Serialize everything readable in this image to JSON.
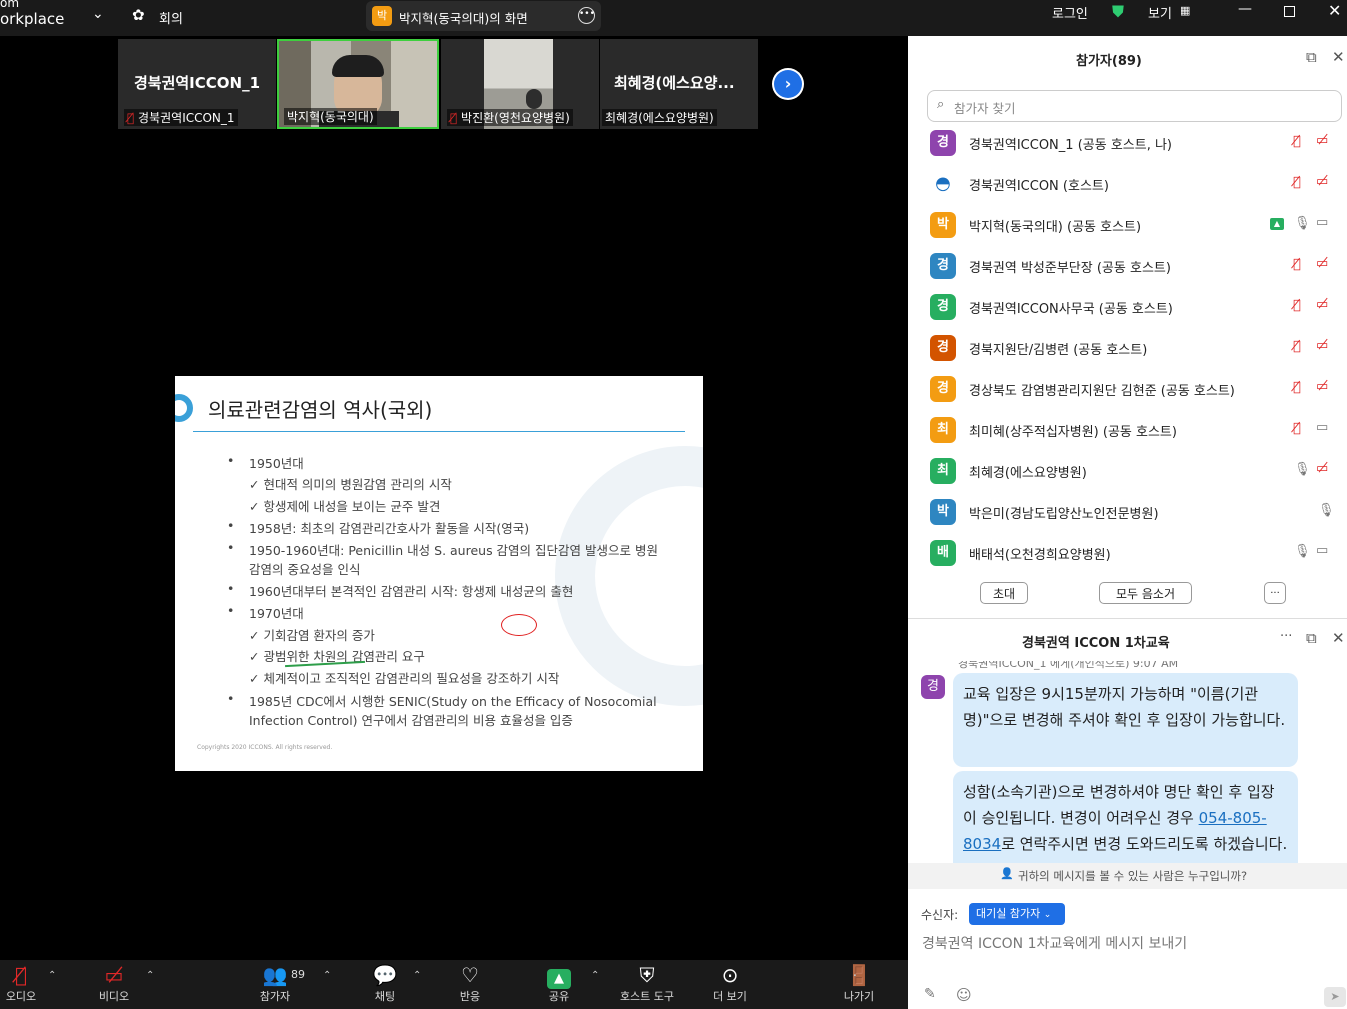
{
  "app": {
    "title_partial": "om",
    "name_partial": "orkplace",
    "meeting_label": "회의"
  },
  "share_banner": {
    "badge": "박",
    "text": "박지혁(동국의대)의 화면"
  },
  "window": {
    "login": "로그인",
    "view": "보기"
  },
  "thumbnails": [
    {
      "big": "경북권역ICCON_1",
      "label": "경북권역ICCON_1"
    },
    {
      "label": "박지혁(동국의대)"
    },
    {
      "label": "박진환(영천요양병원)"
    },
    {
      "big": "최혜경(에스요양...",
      "label": "최혜경(에스요양병원)"
    }
  ],
  "slide": {
    "title": "의료관련감염의 역사(국외)",
    "lines": [
      "1950년대",
      "✓  현대적 의미의 병원감염 관리의 시작",
      "✓  항생제에 내성을 보이는 균주 발견",
      "1958년: 최초의 감염관리간호사가 활동을 시작(영국)",
      "1950-1960년대: Penicillin 내성 S. aureus 감염의 집단감염 발생으로 병원",
      "감염의 중요성을 인식",
      "1960년대부터 본격적인 감염관리 시작: 항생제 내성균의 출현",
      "1970년대",
      "✓  기회감염 환자의 증가",
      "✓  광범위한 차원의 감염관리 요구",
      "✓  체계적이고 조직적인 감염관리의 필요성을 강조하기 시작",
      "1985년 CDC에서 시행한 SENIC(Study on the Efficacy of Nosocomial",
      "Infection Control) 연구에서 감염관리의 비용 효율성을 입증"
    ],
    "footer": "Copyrights 2020 ICCONS. All rights reserved."
  },
  "participants": {
    "title": "참가자(89)",
    "search_placeholder": "참가자 찾기",
    "list": [
      {
        "avatar": "경",
        "color": "#8e44ad",
        "name": "경북권역ICCON_1 (공동 호스트, 나)"
      },
      {
        "avatar": "",
        "color": "#1a6fc0",
        "name": "경북권역ICCON (호스트)"
      },
      {
        "avatar": "박",
        "color": "#f39c12",
        "name": "박지혁(동국의대) (공동 호스트)"
      },
      {
        "avatar": "경",
        "color": "#2e86c1",
        "name": "경북권역 박성준부단장 (공동 호스트)"
      },
      {
        "avatar": "경",
        "color": "#27ae60",
        "name": "경북권역ICCON사무국 (공동 호스트)"
      },
      {
        "avatar": "경",
        "color": "#d35400",
        "name": "경북지원단/김병련 (공동 호스트)"
      },
      {
        "avatar": "경",
        "color": "#f39c12",
        "name": "경상북도 감염병관리지원단 김현준 (공동 호스트)"
      },
      {
        "avatar": "최",
        "color": "#f39c12",
        "name": "최미혜(상주적십자병원) (공동 호스트)"
      },
      {
        "avatar": "최",
        "color": "#27ae60",
        "name": "최혜경(에스요양병원)"
      },
      {
        "avatar": "박",
        "color": "#2e86c1",
        "name": "박은미(경남도립양산노인전문병원)"
      },
      {
        "avatar": "배",
        "color": "#27ae60",
        "name": "배태석(오천경희요양병원)"
      }
    ],
    "invite": "초대",
    "mute_all": "모두 음소거",
    "more": "···"
  },
  "chat": {
    "title": "경북권역 ICCON 1차교육",
    "partial_header": "경북권역ICCON_1 에게(개인적으로) 9:07 AM",
    "avatar": "경",
    "msg1": "교육 입장은 9시15분까지 가능하며 \"이름(기관명)\"으로 변경해 주셔야 확인 후 입장이 가능합니다.",
    "msg2_a": "성함(소속기관)으로 변경하셔야 명단 확인 후 입장이 승인됩니다. 변경이 어려우신 경우 ",
    "msg2_phone": "054-805-8034",
    "msg2_b": "로 연락주시면 변경 도와드리도록 하겠습니다.",
    "who_can_see": "귀하의 메시지를 볼 수 있는 사람은 누구입니까?",
    "to_label": "수신자:",
    "to_value": "대기실 참가자",
    "input_placeholder": "경북권역 ICCON 1차교육에게 메시지 보내기"
  },
  "toolbar": {
    "audio": "오디오",
    "video": "비디오",
    "participants": "참가자",
    "participants_count": "89",
    "chat": "채팅",
    "reactions": "반응",
    "share": "공유",
    "host_tools": "호스트 도구",
    "more": "더 보기",
    "leave": "나가기"
  }
}
